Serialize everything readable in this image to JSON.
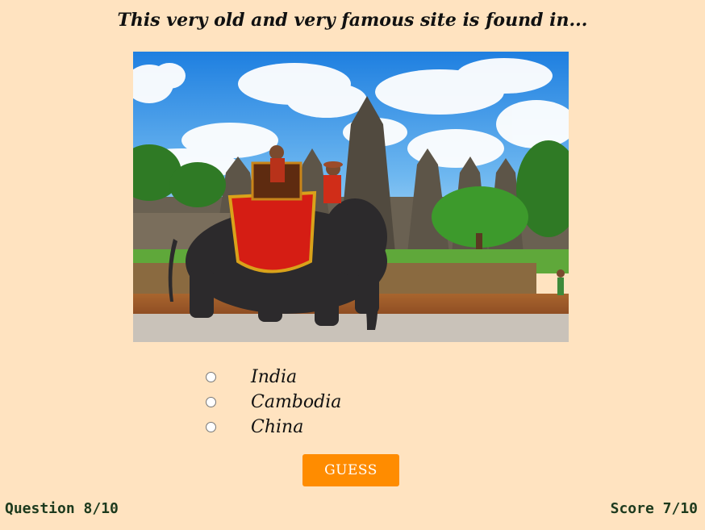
{
  "quiz": {
    "question": "This very old and very famous site is found in...",
    "image_description_icon": "temple-elephant-photo",
    "options": [
      {
        "label": "India"
      },
      {
        "label": "Cambodia"
      },
      {
        "label": "China"
      }
    ],
    "guess_label": "GUESS",
    "progress_text": "Question 8/10",
    "score_text": "Score 7/10"
  },
  "colors": {
    "background": "#ffe3c0",
    "accent": "#ff8c00",
    "footer_text": "#1d3a1d"
  }
}
